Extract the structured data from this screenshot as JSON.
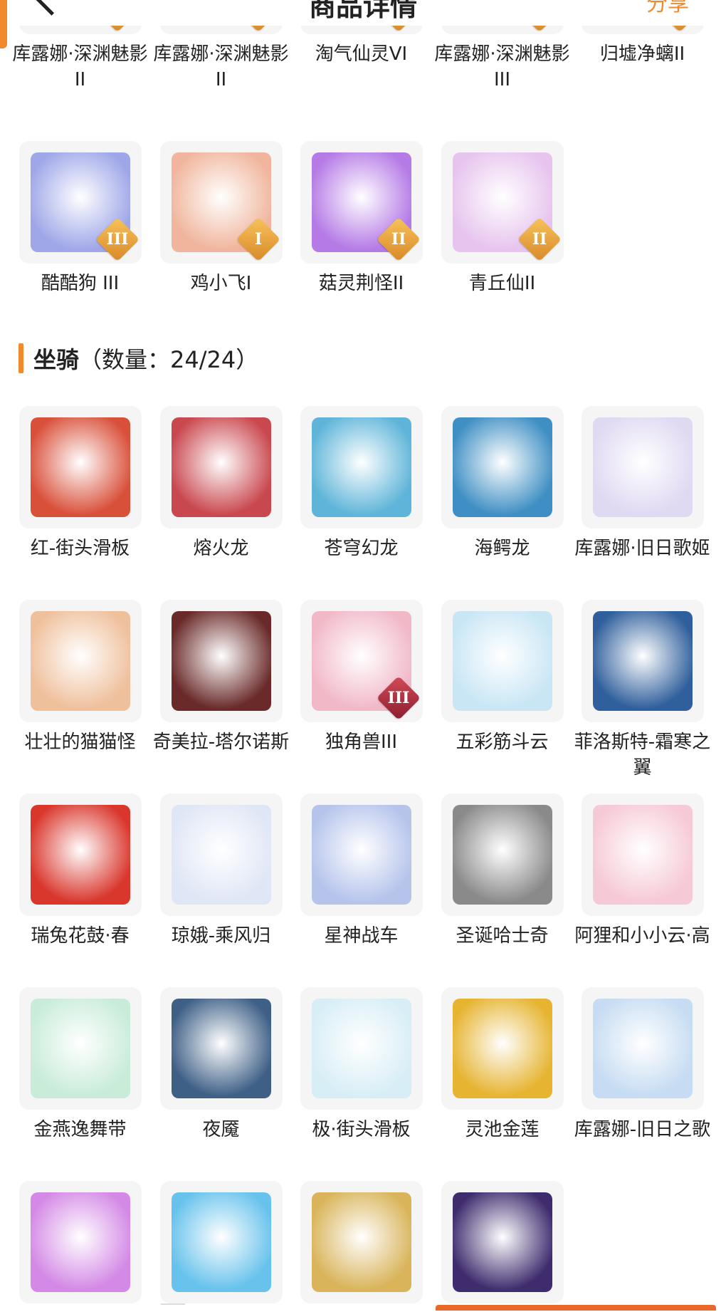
{
  "header": {
    "title": "商品详情",
    "share_label": "分享"
  },
  "pets_top": [
    {
      "label": "库露娜·深渊魅影II",
      "color": "#b7a6e8",
      "tier": "II"
    },
    {
      "label": "库露娜·深渊魅影II",
      "color": "#b9a6e6",
      "tier": "II"
    },
    {
      "label": "淘气仙灵VI",
      "color": "#3b7bd6",
      "tier": "VI"
    },
    {
      "label": "库露娜·深渊魅影III",
      "color": "#c1a9e6",
      "tier": "III"
    },
    {
      "label": "归墟净螭II",
      "color": "#bfe7ea",
      "tier": "II"
    }
  ],
  "pets_second": [
    {
      "label": "酷酷狗 III",
      "color": "#9fa7e8",
      "tier": "III"
    },
    {
      "label": "鸡小飞I",
      "color": "#f0b59c",
      "tier": "I"
    },
    {
      "label": "菇灵荆怪II",
      "color": "#b57ae6",
      "tier": "II"
    },
    {
      "label": "青丘仙II",
      "color": "#e7c4ee",
      "tier": "II"
    }
  ],
  "mounts_section": {
    "title": "坐骑",
    "count_text": "（数量：24/24）"
  },
  "mounts": [
    {
      "label": "红-街头滑板",
      "color": "#d9503a"
    },
    {
      "label": "熔火龙",
      "color": "#c9484f"
    },
    {
      "label": "苍穹幻龙",
      "color": "#5fb5d9"
    },
    {
      "label": "海鳄龙",
      "color": "#3f8fc4"
    },
    {
      "label": "库露娜·旧日歌姬",
      "color": "#dfd9f2"
    },
    {
      "label": "壮壮的猫猫怪",
      "color": "#efc09c"
    },
    {
      "label": "奇美拉-塔尔诺斯",
      "color": "#6a2a2a"
    },
    {
      "label": "独角兽III",
      "color": "#f1b8c8",
      "tier": "III",
      "tier_style": "red"
    },
    {
      "label": "五彩筋斗云",
      "color": "#c9e6f5"
    },
    {
      "label": "菲洛斯特-霜寒之翼",
      "color": "#2f5f9c"
    },
    {
      "label": "瑞兔花鼓·春",
      "color": "#d9362c"
    },
    {
      "label": "琼娥-乘风归",
      "color": "#dfe6f5"
    },
    {
      "label": "星神战车",
      "color": "#b6c4ec"
    },
    {
      "label": "圣诞哈士奇",
      "color": "#8a8a8a"
    },
    {
      "label": "阿狸和小小云·高",
      "color": "#f6c9d6"
    },
    {
      "label": "金燕逸舞带",
      "color": "#c9ecd9"
    },
    {
      "label": "夜魇",
      "color": "#3e5f86"
    },
    {
      "label": "极·街头滑板",
      "color": "#d8eef6"
    },
    {
      "label": "灵池金莲",
      "color": "#e6b431"
    },
    {
      "label": "库露娜-旧日之歌",
      "color": "#c6dcf2"
    },
    {
      "label": "",
      "color": "#d489e6"
    },
    {
      "label": "",
      "color": "#67c2ec"
    },
    {
      "label": "",
      "color": "#d9b45a"
    },
    {
      "label": "",
      "color": "#3f2c6e"
    }
  ]
}
